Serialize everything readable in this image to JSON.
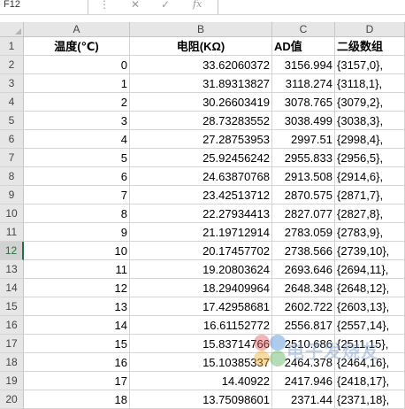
{
  "formula_bar": {
    "name_box": "F12",
    "cancel_icon": "✕",
    "enter_icon": "✓",
    "fx": "fx",
    "formula": ""
  },
  "columns": [
    "A",
    "B",
    "C",
    "D"
  ],
  "headers": {
    "temp": "温度(℃)",
    "resistance": "电阻(KΩ)",
    "ad": "AD值",
    "array": "二级数组"
  },
  "active_row": 12,
  "rows": [
    {
      "n": "2",
      "temp": "0",
      "r": "33.62060372",
      "ad": "3156.994",
      "arr": "{3157,0},"
    },
    {
      "n": "3",
      "temp": "1",
      "r": "31.89313827",
      "ad": "3118.274",
      "arr": "{3118,1},"
    },
    {
      "n": "4",
      "temp": "2",
      "r": "30.26603419",
      "ad": "3078.765",
      "arr": "{3079,2},"
    },
    {
      "n": "5",
      "temp": "3",
      "r": "28.73283552",
      "ad": "3038.499",
      "arr": "{3038,3},"
    },
    {
      "n": "6",
      "temp": "4",
      "r": "27.28753953",
      "ad": "2997.51",
      "arr": "{2998,4},"
    },
    {
      "n": "7",
      "temp": "5",
      "r": "25.92456242",
      "ad": "2955.833",
      "arr": "{2956,5},"
    },
    {
      "n": "8",
      "temp": "6",
      "r": "24.63870768",
      "ad": "2913.508",
      "arr": "{2914,6},"
    },
    {
      "n": "9",
      "temp": "7",
      "r": "23.42513712",
      "ad": "2870.575",
      "arr": "{2871,7},"
    },
    {
      "n": "10",
      "temp": "8",
      "r": "22.27934413",
      "ad": "2827.077",
      "arr": "{2827,8},"
    },
    {
      "n": "11",
      "temp": "9",
      "r": "21.19712914",
      "ad": "2783.059",
      "arr": "{2783,9},"
    },
    {
      "n": "12",
      "temp": "10",
      "r": "20.17457702",
      "ad": "2738.566",
      "arr": "{2739,10},"
    },
    {
      "n": "13",
      "temp": "11",
      "r": "19.20803624",
      "ad": "2693.646",
      "arr": "{2694,11},"
    },
    {
      "n": "14",
      "temp": "12",
      "r": "18.29409964",
      "ad": "2648.348",
      "arr": "{2648,12},"
    },
    {
      "n": "15",
      "temp": "13",
      "r": "17.42958681",
      "ad": "2602.722",
      "arr": "{2603,13},"
    },
    {
      "n": "16",
      "temp": "14",
      "r": "16.61152772",
      "ad": "2556.817",
      "arr": "{2557,14},"
    },
    {
      "n": "17",
      "temp": "15",
      "r": "15.83714766",
      "ad": "2510.686",
      "arr": "{2511,15},"
    },
    {
      "n": "18",
      "temp": "16",
      "r": "15.10385337",
      "ad": "2464.378",
      "arr": "{2464,16},"
    },
    {
      "n": "19",
      "temp": "17",
      "r": "14.40922",
      "ad": "2417.946",
      "arr": "{2418,17},"
    },
    {
      "n": "20",
      "temp": "18",
      "r": "13.75098601",
      "ad": "2371.44",
      "arr": "{2371,18},"
    }
  ],
  "watermark": {
    "text": "电子发烧友",
    "colors": [
      "#e05a5a",
      "#4a8fd6",
      "#f0b030",
      "#5ab35a"
    ]
  }
}
